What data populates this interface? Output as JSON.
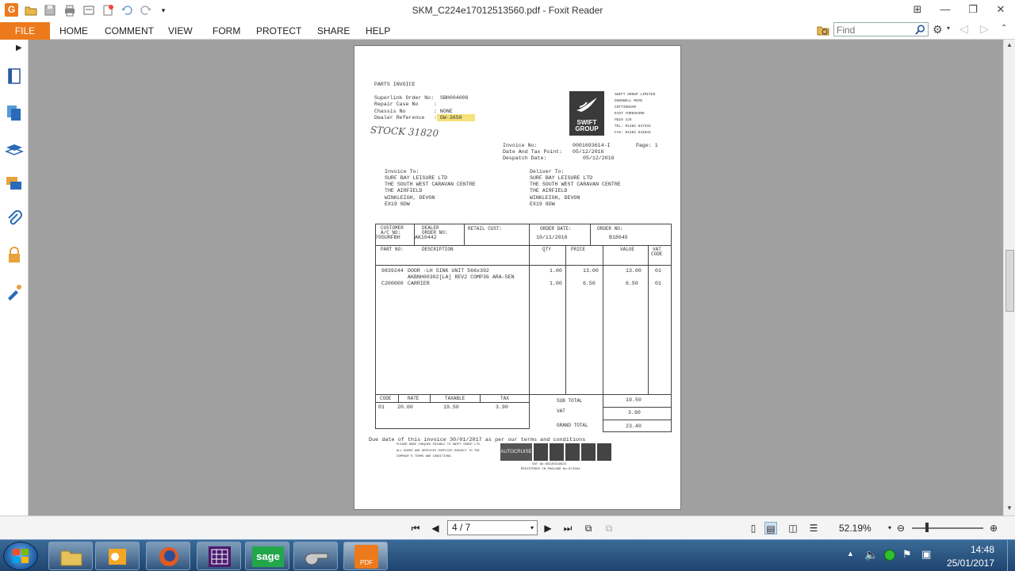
{
  "window": {
    "title": "SKM_C224e17012513560.pdf - Foxit Reader",
    "app_icon_letter": "G"
  },
  "menu": {
    "file": "FILE",
    "items": [
      "HOME",
      "COMMENT",
      "VIEW",
      "FORM",
      "PROTECT",
      "SHARE",
      "HELP"
    ],
    "find_placeholder": "Find"
  },
  "statusbar": {
    "page_display": "4 / 7",
    "zoom": "52.19%"
  },
  "taskbar": {
    "time": "14:48",
    "date": "25/01/2017",
    "apps": [
      "file-explorer",
      "outlook",
      "firefox",
      "grid-app",
      "sage",
      "whistle-app",
      "foxit-pdf"
    ],
    "pdf_label": "PDF",
    "sage_label": "sage"
  },
  "invoice": {
    "heading": "PARTS INVOICE",
    "order_no_label": "Superlink Order No:",
    "order_no": "SBH004006",
    "repair_case_label": "Repair Case No",
    "repair_case": ":",
    "chassis_label": "Chassis No",
    "chassis": ": NONE",
    "dealer_ref_label": "Dealer Reference",
    "dealer_ref": ": GW-3650",
    "handwritten": "STOCK 31820",
    "company": {
      "logo_text": "SWIFT GROUP",
      "lines": [
        "SWIFT GROUP LIMITED",
        "DUNSWELL ROAD",
        "COTTINGHAM",
        "EAST YORKSHIRE",
        "HU16 4JX",
        "TEL: 01482 847332",
        "FAX: 01482 841042"
      ]
    },
    "invoice_no_label": "Invoice No:",
    "invoice_no": "0001693614-I",
    "page_label": "Page: 1",
    "date_tax_label": "Date And Tax Point:",
    "date_tax": "05/12/2016",
    "despatch_label": "Despatch Date:",
    "despatch": "05/12/2016",
    "invoice_to_label": "Invoice To:",
    "invoice_to": [
      "SURF BAY LEISURE LTD",
      "THE SOUTH WEST CARAVAN CENTRE",
      "THE AIRFIELD",
      "WINKLEIGH, DEVON",
      "EX19 8DW"
    ],
    "deliver_to_label": "Deliver To:",
    "deliver_to": [
      "SURF BAY LEISURE LTD",
      "THE SOUTH WEST CARAVAN CENTRE",
      "THE AIRFIELD",
      "WINKLEIGH, DEVON",
      "EX19 8DW"
    ],
    "header": {
      "customer_label_1": "CUSTOMER",
      "customer_label_2": "A/C NO:",
      "customer_value": "70SURFBH",
      "dealer_label_1": "DEALER",
      "dealer_label_2": "ORDER NO:",
      "dealer_value": "AK10442",
      "retail_label": "RETAIL CUST:",
      "order_date_label": "ORDER DATE:",
      "order_date": "10/11/2016",
      "order_no_label": "ORDER NO:",
      "order_no_value": "B18645"
    },
    "columns": {
      "part_no": "PART NO:",
      "description": "DESCRIPTION",
      "qty": "QTY",
      "price": "PRICE",
      "value": "VALUE",
      "vat_code_1": "VAT",
      "vat_code_2": "CODE"
    },
    "lines": [
      {
        "part": "9839244",
        "desc": "DOOR -LH SINK UNIT 566x392",
        "desc2": "AKBNH00302[LA] REV2 COMP36 ARA-SEN",
        "qty": "1.00",
        "price": "13.00",
        "value": "13.00",
        "vat": "01"
      },
      {
        "part": "C200000",
        "desc": "CARRIER",
        "desc2": "",
        "qty": "1.00",
        "price": "6.50",
        "value": "6.50",
        "vat": "01"
      }
    ],
    "vat_table": {
      "headers": [
        "CODE",
        "RATE",
        "TAXABLE",
        "TAX"
      ],
      "row": [
        "01",
        "20.00",
        "19.50",
        "3.90"
      ]
    },
    "totals": {
      "sub_total_label": "SUB TOTAL",
      "sub_total": "19.50",
      "vat_label": "VAT",
      "vat": "3.90",
      "grand_total_label": "GRAND TOTAL",
      "grand_total": "23.40"
    },
    "due_text": "Due date of this invoice 30/01/2017 as per our terms and conditions",
    "footer_notes": [
      "PLEASE MAKE CHEQUES PAYABLE TO SWIFT GROUP LTD.",
      "ALL GOODS AND SERVICES SUPPLIED SUBJECT TO THE",
      "COMPANY'S TERMS AND CONDITIONS."
    ],
    "footer_logo": "AUTOCRUISE",
    "vat_no": "VAT No:GB135539622",
    "registered": "REGISTERED IN ENGLAND No:672694"
  }
}
